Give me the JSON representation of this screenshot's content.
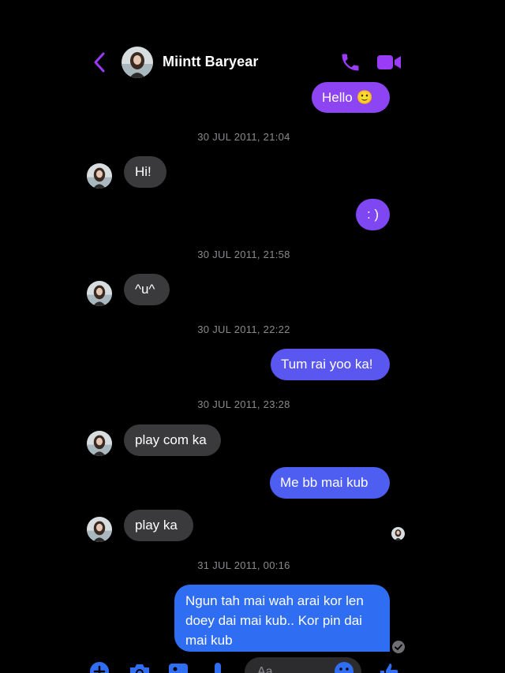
{
  "header": {
    "contact_name": "Miintt Baryear",
    "back_icon": "chevron-left-icon",
    "call_icon": "phone-icon",
    "video_icon": "video-camera-icon"
  },
  "colors": {
    "accent_purple": "#9a3cf5",
    "bubble_incoming": "#3a3a3c",
    "bubble_out_top": "#8d44f2",
    "bubble_out_mid": "#5a56f0",
    "bubble_out_bottom": "#2f6ef2",
    "timestamp": "#8a8a8e"
  },
  "messages": {
    "m1": "Hello 🙂",
    "ts1": "30 JUL 2011, 21:04",
    "m2": "Hi!",
    "m3": ": )",
    "ts2": "30 JUL 2011, 21:58",
    "m4": "^u^",
    "ts3": "30 JUL 2011, 22:22",
    "m5": "Tum rai yoo ka!",
    "ts4": "30 JUL 2011, 23:28",
    "m6": "play com ka",
    "m7": "Me bb mai kub",
    "m8": "play ka",
    "ts5": "31 JUL 2011, 00:16",
    "m9": "Ngun tah mai wah arai kor len doey dai mai kub.. Kor pin dai mai kub"
  },
  "composer": {
    "placeholder": "Aa"
  },
  "toolbar_icons": [
    "plus-circle-icon",
    "camera-icon",
    "photo-icon",
    "microphone-icon",
    "emoji-icon",
    "thumbs-up-icon"
  ]
}
